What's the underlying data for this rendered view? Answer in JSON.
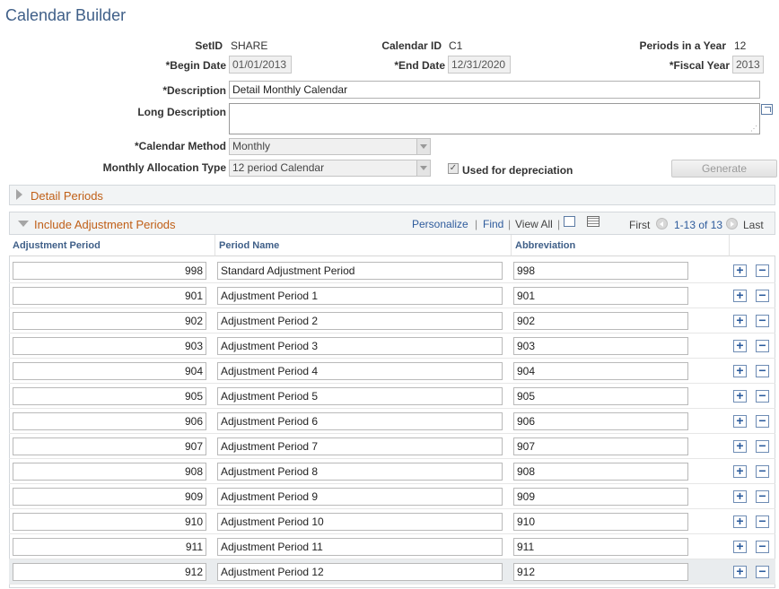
{
  "page": {
    "title": "Calendar Builder"
  },
  "header": {
    "setid_label": "SetID",
    "setid_value": "SHARE",
    "calendar_id_label": "Calendar ID",
    "calendar_id_value": "C1",
    "periods_label": "Periods in a Year",
    "periods_value": "12",
    "begin_date_label": "*Begin Date",
    "begin_date_value": "01/01/2013",
    "end_date_label": "*End Date",
    "end_date_value": "12/31/2020",
    "fiscal_year_label": "*Fiscal Year",
    "fiscal_year_value": "2013",
    "description_label": "*Description",
    "description_value": "Detail Monthly Calendar",
    "long_description_label": "Long Description",
    "long_description_value": "",
    "calendar_method_label": "*Calendar Method",
    "calendar_method_value": "Monthly",
    "allocation_type_label": "Monthly Allocation Type",
    "allocation_type_value": "12 period Calendar",
    "depreciation_label": "Used for depreciation",
    "depreciation_checked": true,
    "generate_label": "Generate"
  },
  "detail_periods": {
    "title": "Detail Periods",
    "collapsed": true
  },
  "adjustments": {
    "title": "Include Adjustment Periods",
    "toolbar": {
      "personalize": "Personalize",
      "sep1": "|",
      "find": "Find",
      "sep2": "|",
      "view_all": "View All",
      "sep3": "|",
      "first": "First",
      "range": "1-13 of 13",
      "last": "Last"
    },
    "columns": [
      "Adjustment Period",
      "Period Name",
      "Abbreviation"
    ],
    "rows": [
      {
        "period": "998",
        "name": "Standard Adjustment Period",
        "abbr": "998"
      },
      {
        "period": "901",
        "name": "Adjustment Period 1",
        "abbr": "901"
      },
      {
        "period": "902",
        "name": "Adjustment Period 2",
        "abbr": "902"
      },
      {
        "period": "903",
        "name": "Adjustment Period 3",
        "abbr": "903"
      },
      {
        "period": "904",
        "name": "Adjustment Period 4",
        "abbr": "904"
      },
      {
        "period": "905",
        "name": "Adjustment Period 5",
        "abbr": "905"
      },
      {
        "period": "906",
        "name": "Adjustment Period 6",
        "abbr": "906"
      },
      {
        "period": "907",
        "name": "Adjustment Period 7",
        "abbr": "907"
      },
      {
        "period": "908",
        "name": "Adjustment Period 8",
        "abbr": "908"
      },
      {
        "period": "909",
        "name": "Adjustment Period 9",
        "abbr": "909"
      },
      {
        "period": "910",
        "name": "Adjustment Period 10",
        "abbr": "910"
      },
      {
        "period": "911",
        "name": "Adjustment Period 11",
        "abbr": "911"
      },
      {
        "period": "912",
        "name": "Adjustment Period 12",
        "abbr": "912"
      }
    ],
    "add_symbol": "+",
    "delete_symbol": "−"
  },
  "colors": {
    "title": "#3f5f88",
    "section_title": "#c05f17",
    "link": "#2e5b9c"
  },
  "icons": [
    "expand-icon",
    "zoom-icon",
    "download-grid-icon",
    "prev-icon",
    "next-icon",
    "add-row-icon",
    "delete-row-icon"
  ]
}
